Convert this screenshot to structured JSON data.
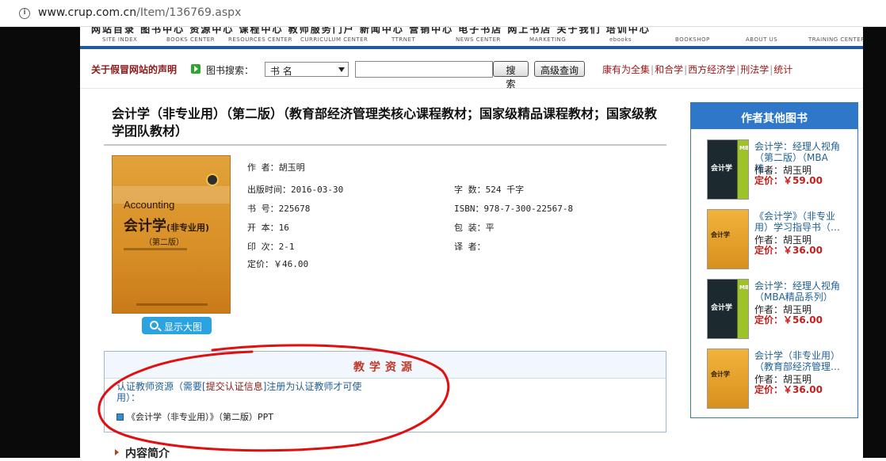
{
  "browser": {
    "info_icon": "i",
    "url_host": "www.crup.com.cn",
    "url_path": "/Item/136769.aspx"
  },
  "nav": {
    "cut_text": "网站目录    图书中心    资源中心    课程中心    教师服务门户    新闻中心    营销中心    电子书店    网上书店    关于我们    培训中心",
    "items": [
      "SITE INDEX",
      "BOOKS CENTER",
      "RESOURCES CENTER",
      "CURRICULUM CENTER",
      "TTRNET",
      "NEWS CENTER",
      "MARKETING",
      "ebooks",
      "BOOKSHOP",
      "ABOUT US",
      "TRAINING CENTER"
    ],
    "accent": "#1f59a8"
  },
  "search": {
    "declaration": "关于假冒网站的声明",
    "label": "图书搜索：",
    "field_selected": "书  名",
    "query_value": "",
    "search_button": "搜 索",
    "advanced_button": "高级查询",
    "quick_links": [
      "康有为全集",
      "和合学",
      "西方经济学",
      "刑法学",
      "统计"
    ]
  },
  "book": {
    "title": "会计学（非专业用）（第二版）（教育部经济管理类核心课程教材；国家级精品课程教材；国家级教学团队教材）",
    "cover": {
      "en": "Accounting",
      "cn": "会计学",
      "cn_sub": "(非专业用)",
      "edition": "（第二版）"
    },
    "zoom_button": "显示大图",
    "author_label": "作   者：",
    "author": "胡玉明",
    "pubdate_label": "出版时间：",
    "pubdate": "2016-03-30",
    "words_label": "字   数：",
    "words": "524 千字",
    "bookno_label": "书   号：",
    "bookno": "225678",
    "isbn_label": "ISBN：",
    "isbn": "978-7-300-22567-8",
    "format_label": "开   本：",
    "format": "16",
    "binding_label": "包   装：",
    "binding": "平",
    "print_label": "印   次：",
    "print": "2-1",
    "translator_label": "译 者：",
    "translator": "",
    "price_label": "定价：",
    "price": "￥46.00"
  },
  "resources": {
    "heading": "教学资源",
    "note_pre": "认证教师资源（需要[",
    "note_link": "提交认证信息",
    "note_post": "]注册为认证教师才可使用）：",
    "file": "《会计学（非专业用）》（第二版）PPT",
    "annotation_color": "#e01010"
  },
  "intro": {
    "heading": "内容简介"
  },
  "author_books": {
    "heading": "作者其他图书",
    "author_label": "作者：",
    "price_label": "定价：",
    "items": [
      {
        "title": "会计学：经理人视角（第二版）（MBA精…",
        "author": "胡玉明",
        "price": "￥59.00",
        "cover": "mba"
      },
      {
        "title": "《会计学》（非专业用）学习指导书（…",
        "author": "胡玉明",
        "price": "￥36.00",
        "cover": "orange"
      },
      {
        "title": "会计学：经理人视角（MBA精品系列）",
        "author": "胡玉明",
        "price": "￥56.00",
        "cover": "mba"
      },
      {
        "title": "会计学（非专业用）（教育部经济管理…",
        "author": "胡玉明",
        "price": "￥36.00",
        "cover": "orange"
      }
    ]
  }
}
